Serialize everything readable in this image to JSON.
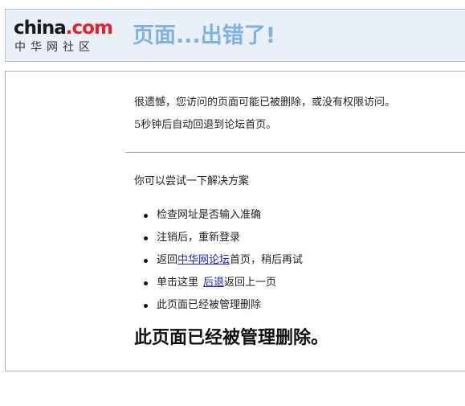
{
  "header": {
    "logo_main": "china",
    "logo_com": ".com",
    "logo_sub": "中华网社区",
    "title": "页面...出错了!"
  },
  "content": {
    "message_line1": "很遗憾，您访问的页面可能已被删除，或没有权限访问。",
    "message_line2": "5秒钟后自动回退到论坛首页。",
    "try_text": "你可以尝试一下解决方案",
    "solutions": {
      "item1": "检查网址是否输入准确",
      "item2": "注销后，重新登录",
      "item3_prefix": "返回",
      "item3_link": "中华网论坛",
      "item3_suffix": "首页，稍后再试",
      "item4_prefix": "单击这里",
      "item4_link": "后退",
      "item4_suffix": "返回上一页",
      "item5": "此页面已经被管理删除"
    },
    "big_notice": "此页面已经被管理删除。"
  },
  "colors": {
    "header_bg": "#eaf0f8",
    "title": "#7fb2e2",
    "logo_com": "#e8202a",
    "link": "#1a22cc"
  }
}
